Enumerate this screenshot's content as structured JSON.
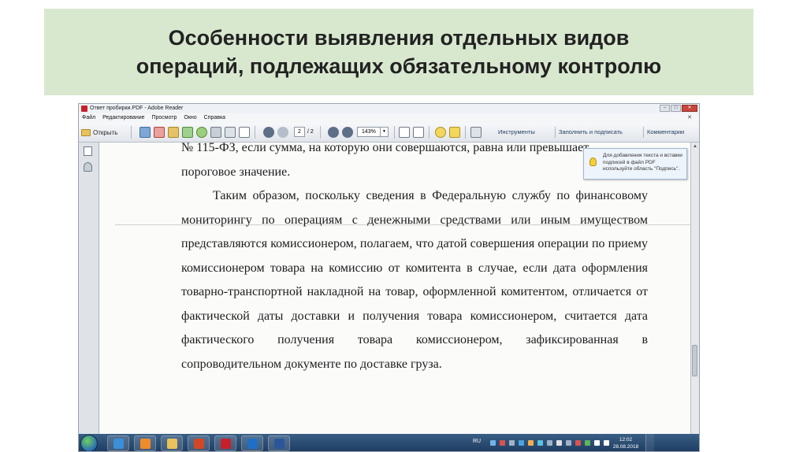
{
  "slide": {
    "title_line1": "Особенности выявления отдельных видов",
    "title_line2": "операций, подлежащих обязательному контролю"
  },
  "window": {
    "title": "Ответ пробирки.PDF - Adobe Reader",
    "controls": [
      "–",
      "□",
      "✕"
    ]
  },
  "menu": {
    "items": [
      "Файл",
      "Редактирование",
      "Просмотр",
      "Окно",
      "Справка"
    ],
    "close_doc": "✕"
  },
  "toolbar": {
    "open_label": "Открыть",
    "page_current": "2",
    "page_total": "/ 2",
    "zoom": "143%",
    "tools_label": "Инструменты",
    "fill_sign_label": "Заполнить и подписать",
    "comments_label": "Комментарии"
  },
  "tooltip": {
    "text": "Для добавления текста и вставки подписей в файл PDF используйте область \"Подпись\"."
  },
  "document": {
    "line_top": "№ 115-ФЗ, если сумма, на которую они совершаются, равна или превышает",
    "line_threshold": "пороговое значение.",
    "paragraph": "Таким образом, поскольку сведения в Федеральную службу по финансовому мониторингу по операциям с денежными средствами или иным имуществом представляются комиссионером, полагаем, что датой совершения операции по приему комиссионером товара на комиссию от комитента в случае, если дата оформления товарно-транспортной накладной на товар, оформленной комитентом, отличается от фактической даты доставки и получения товара комиссионером, считается дата фактического получения товара комиссионером, зафиксированная в сопроводительном документе по доставке груза."
  },
  "taskbar": {
    "apps": [
      "internet-explorer",
      "media-player",
      "explorer",
      "powerpoint",
      "adobe-reader",
      "outlook",
      "word"
    ],
    "language": "RU",
    "time": "12:02",
    "date": "28.08.2018"
  },
  "colors": {
    "slide_title_bg": "#d8e8cf",
    "taskbar": "#1d3a5e",
    "reader_red": "#c8202a"
  }
}
